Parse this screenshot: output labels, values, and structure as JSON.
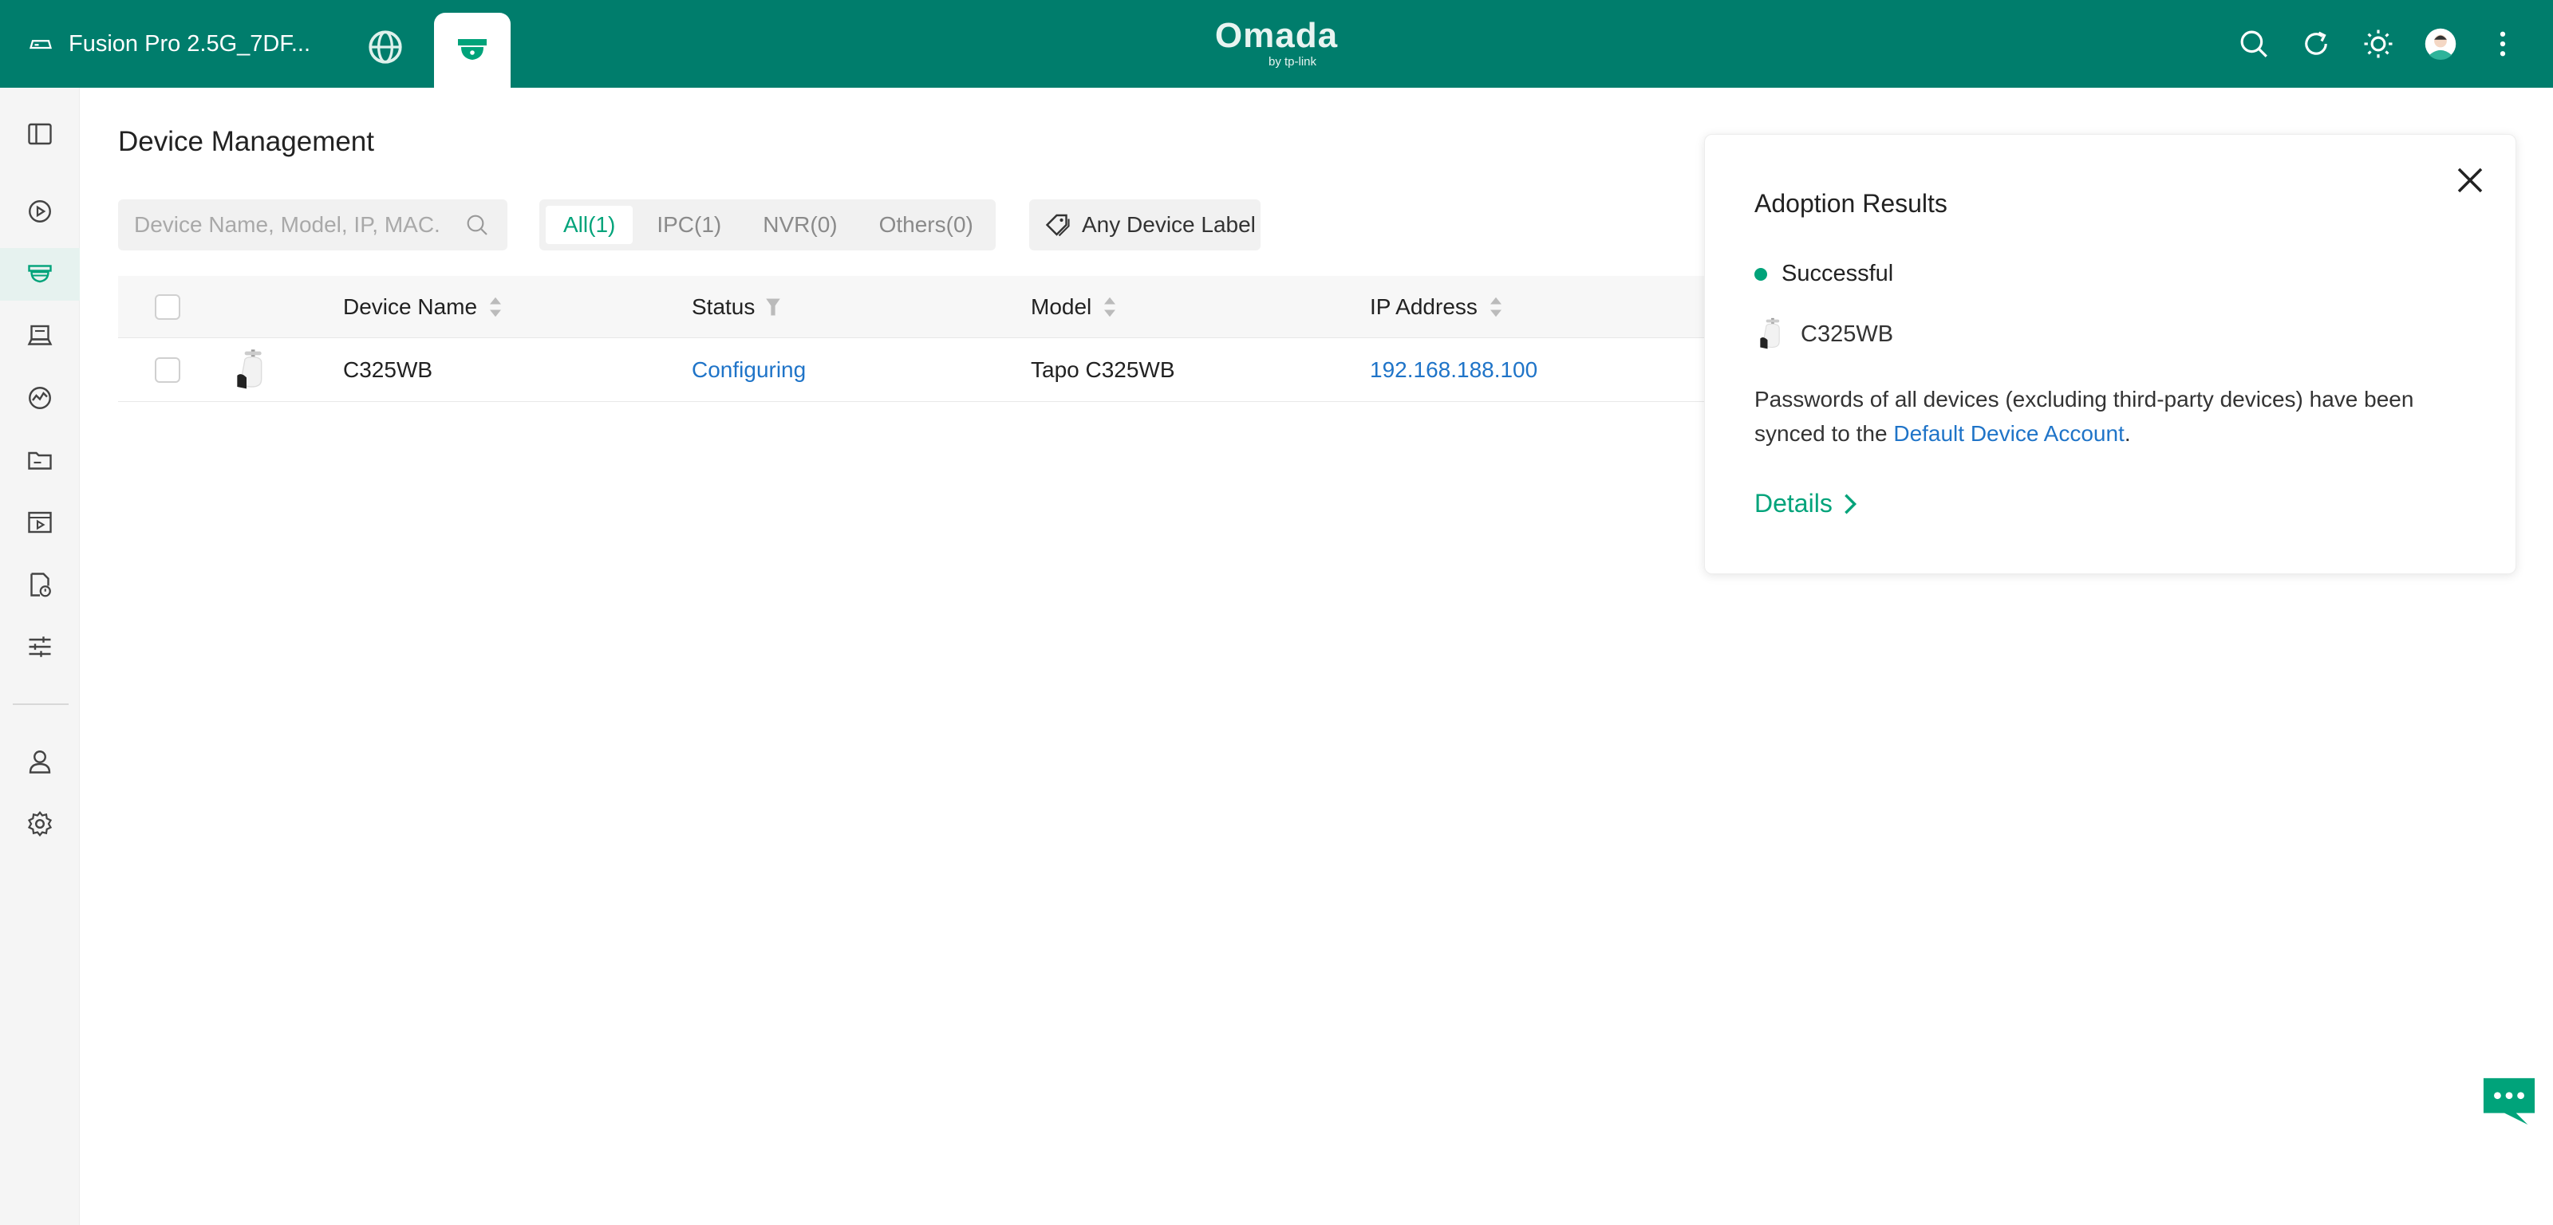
{
  "header": {
    "site_name": "Fusion Pro 2.5G_7DF...",
    "logo_brand": "Omada",
    "logo_sub": "by tp-link",
    "icons": [
      "router-icon",
      "globe-icon",
      "camera-icon",
      "search-icon",
      "refresh-icon",
      "theme-icon",
      "avatar",
      "more-icon"
    ]
  },
  "sidebar": {
    "items": [
      "collapse-icon",
      "play-icon",
      "camera-icon",
      "monitor-icon",
      "analytics-icon",
      "folder-icon",
      "video-icon",
      "report-icon",
      "settings-sliders-icon",
      "user-icon",
      "gear-icon"
    ]
  },
  "main": {
    "title": "Device Management",
    "search_placeholder": "Device Name, Model, IP, MAC.",
    "filters": [
      "All(1)",
      "IPC(1)",
      "NVR(0)",
      "Others(0)"
    ],
    "active_filter": "All(1)",
    "label_button": "Any Device Label",
    "table": {
      "columns": [
        "Device Name",
        "Status",
        "Model",
        "IP Address"
      ],
      "rows": [
        {
          "name": "C325WB",
          "status": "Configuring",
          "model": "Tapo C325WB",
          "ip": "192.168.188.100"
        }
      ]
    }
  },
  "panel": {
    "title": "Adoption Results",
    "status": "Successful",
    "device": "C325WB",
    "message_before": "Passwords of all devices (excluding third-party devices) have been synced to the ",
    "message_link": "Default Device Account",
    "message_after": ".",
    "details_label": "Details"
  },
  "colors": {
    "header_bg": "#007d6c",
    "accent": "#00a37a",
    "link": "#1f74c8"
  }
}
